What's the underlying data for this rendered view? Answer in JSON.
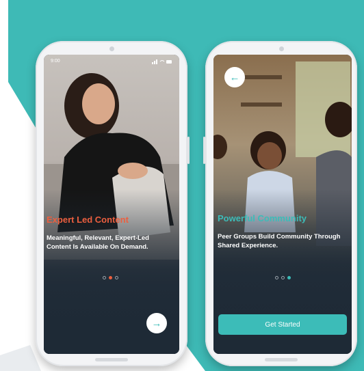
{
  "colors": {
    "accent": "#3cbcb8",
    "title_orange": "#ec5f3f",
    "screen_dark": "#1e2a36"
  },
  "left_screen": {
    "status_time": "9:00",
    "title": "Expert Led Content",
    "body": "Meaningful, Relevant, Expert-Led Content Is Available On Demand.",
    "pagination_active": 2,
    "next_icon": "arrow-right-icon",
    "next_glyph": "→"
  },
  "right_screen": {
    "title": "Powerful Community",
    "body": "Peer Groups Build Community Through Shared Experience.",
    "pagination_active": 3,
    "back_icon": "arrow-left-icon",
    "back_glyph": "←",
    "cta_label": "Get Started"
  }
}
